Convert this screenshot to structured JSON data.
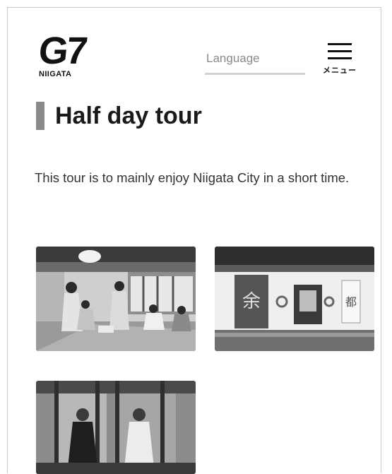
{
  "header": {
    "logo_main": "G7",
    "logo_sub": "NIIGATA",
    "language_label": "Language",
    "menu_label": "メニュー"
  },
  "page": {
    "title": "Half day tour",
    "description": "This tour is to mainly enjoy Niigata City in a short time."
  },
  "gallery": {
    "items": [
      {
        "depicts": "geisha performance in tatami room"
      },
      {
        "depicts": "traditional building with noren curtains"
      },
      {
        "depicts": "two women in kimono seated by window"
      }
    ]
  }
}
